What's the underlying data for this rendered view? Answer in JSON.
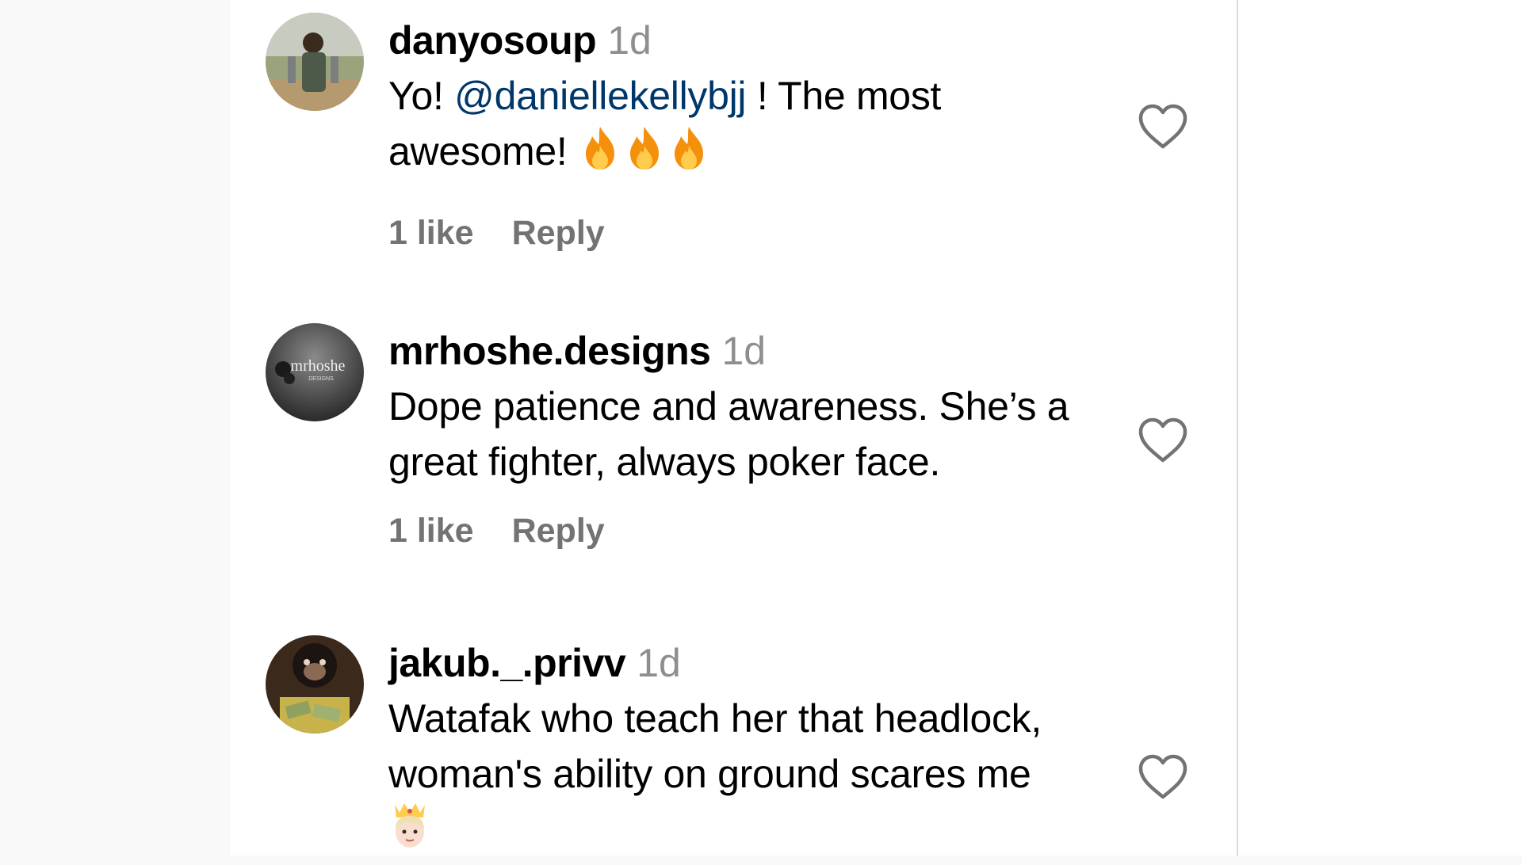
{
  "comments": [
    {
      "username": "danyosoup",
      "time": "1d",
      "text_before": "Yo! ",
      "mention": "@daniellekellybjj",
      "text_after": " ! The most",
      "text_line2": "awesome! ",
      "emoji": [
        "fire-emoji",
        "fire-emoji",
        "fire-emoji"
      ],
      "likes": "1 like",
      "reply": "Reply"
    },
    {
      "username": "mrhoshe.designs",
      "time": "1d",
      "text_line1": "Dope patience and awareness. She’s a",
      "text_line2": "great fighter, always poker face.",
      "avatar_text": "mrhoshe",
      "avatar_subtext": "DESIGNS",
      "likes": "1 like",
      "reply": "Reply"
    },
    {
      "username": "jakub._.privv",
      "time": "1d",
      "text_line1": "Watafak who teach her that headlock,",
      "text_line2": "woman's ability on ground scares me",
      "emoji": [
        "princess-emoji"
      ]
    }
  ],
  "colors": {
    "mention": "#00376b",
    "secondary_text": "#737373",
    "timestamp": "#8e8e8e"
  }
}
